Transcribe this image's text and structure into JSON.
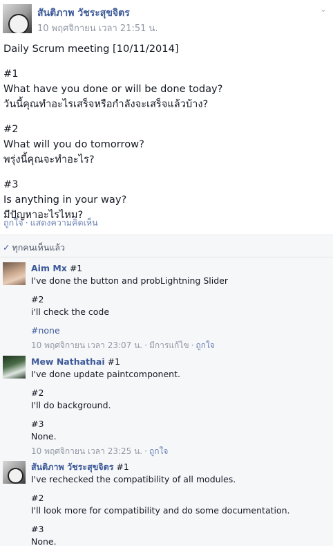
{
  "post": {
    "author": "สันติภาพ วัชระสุขจิตร",
    "timestamp": "10 พฤศจิกายน เวลา 21:51 น.",
    "menu_icon": "chevron-down-icon",
    "lines": [
      "Daily Scrum meeting [10/11/2014]",
      "",
      "#1",
      "What have you done or will be done today?",
      "วันนี้คุณทำอะไรเสร็จหรือกำลังจะเสร็จแล้วบ้าง?",
      "",
      "#2",
      "What will you do tomorrow?",
      "พรุ่งนี้คุณจะทำอะไร?",
      "",
      "#3",
      "Is anything in your way?",
      "มีปัญหาอะไรไหม?"
    ],
    "actions": {
      "like": "ถูกใจ",
      "comment": "แสดงความคิดเห็น"
    }
  },
  "seen": {
    "label": "ทุกคนเห็นแล้ว"
  },
  "comments": [
    {
      "name": "Aim Mx",
      "first": "#1",
      "lines": [
        "I've done the button and probLightning Slider",
        "",
        "#2",
        "i'll check the code",
        "",
        "#none"
      ],
      "time": "10 พฤศจิกายน เวลา 23:07 น.",
      "edited": "มีการแก้ไข",
      "like": "ถูกใจ"
    },
    {
      "name": "Mew Nathathai",
      "first": "#1",
      "lines": [
        "I've done update paintcomponent.",
        "",
        "#2",
        "I'll do background.",
        "",
        "#3",
        "None."
      ],
      "time": "10 พฤศจิกายน เวลา 23:25 น.",
      "like": "ถูกใจ"
    },
    {
      "name": "สันติภาพ วัชระสุขจิตร",
      "first": "#1",
      "lines": [
        "I've rechecked the compatibility of all modules.",
        "",
        "#2",
        "I'll look more for compatibility and do some documentation.",
        "",
        "#3",
        "None."
      ]
    }
  ]
}
